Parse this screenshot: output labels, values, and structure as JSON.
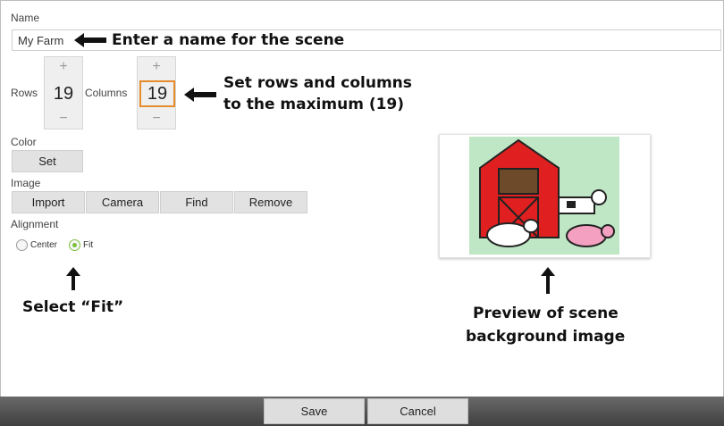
{
  "fields": {
    "name_label": "Name",
    "name_value": "My Farm",
    "rows_label": "Rows",
    "rows_value": "19",
    "columns_label": "Columns",
    "columns_value": "19",
    "stepper_plus": "+",
    "stepper_minus": "−",
    "color_label": "Color",
    "color_set_button": "Set",
    "image_label": "Image",
    "image_buttons": [
      "Import",
      "Camera",
      "Find",
      "Remove"
    ],
    "alignment_label": "Alignment",
    "alignment_options": [
      "Center",
      "Fit"
    ],
    "alignment_selected": "Fit"
  },
  "footer": {
    "save_label": "Save",
    "cancel_label": "Cancel"
  },
  "annotations": {
    "name_callout": "Enter a name for the scene",
    "rows_cols_callout_line1": "Set rows and columns",
    "rows_cols_callout_line2": "to the maximum (19)",
    "fit_callout": "Select “Fit”",
    "preview_callout_line1": "Preview of scene",
    "preview_callout_line2": "background image"
  },
  "colors": {
    "focus_orange": "#e68c2f",
    "radio_green": "#7cbf3a",
    "preview_bg": "#bfe6c5",
    "barn_red": "#e02020"
  },
  "icons": {
    "arrow_left": "left-arrow-icon",
    "arrow_up": "up-arrow-icon"
  }
}
